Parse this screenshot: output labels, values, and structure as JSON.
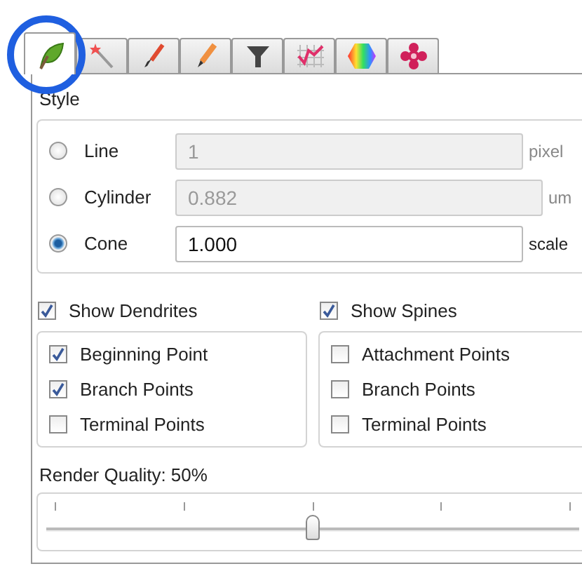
{
  "tabs": [
    {
      "selected": true
    },
    {
      "selected": false
    },
    {
      "selected": false
    },
    {
      "selected": false
    },
    {
      "selected": false
    },
    {
      "selected": false
    },
    {
      "selected": false
    },
    {
      "selected": false
    }
  ],
  "style": {
    "title": "Style",
    "options": [
      {
        "label": "Line",
        "selected": false,
        "value": "1",
        "unit": "pixel",
        "disabled": true
      },
      {
        "label": "Cylinder",
        "selected": false,
        "value": "0.882",
        "unit": "um",
        "disabled": true
      },
      {
        "label": "Cone",
        "selected": true,
        "value": "1.000",
        "unit": "scale",
        "disabled": false
      }
    ]
  },
  "groups": [
    {
      "label": "Show Dendrites",
      "checked": true,
      "items": [
        {
          "label": "Beginning Point",
          "checked": true
        },
        {
          "label": "Branch Points",
          "checked": true
        },
        {
          "label": "Terminal Points",
          "checked": false
        }
      ]
    },
    {
      "label": "Show Spines",
      "checked": true,
      "items": [
        {
          "label": "Attachment Points",
          "checked": false
        },
        {
          "label": "Branch Points",
          "checked": false
        },
        {
          "label": "Terminal Points",
          "checked": false
        }
      ]
    }
  ],
  "quality": {
    "label": "Render Quality: 50%",
    "level": 0.5
  }
}
